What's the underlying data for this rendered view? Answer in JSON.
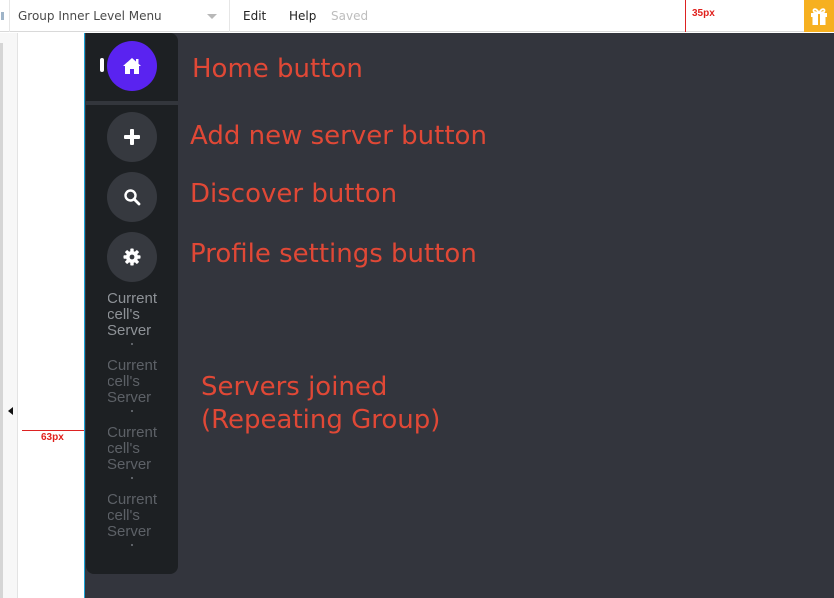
{
  "topbar": {
    "page_selector": "Group Inner Level Menu",
    "menu": [
      "Edit",
      "Help"
    ],
    "status": "Saved",
    "ruler_top_label": "35px",
    "gift_icon": "gift-icon"
  },
  "editor": {
    "ruler_left_label": "63px",
    "collapse_icon": "triangle-left-icon"
  },
  "sidebar": {
    "home_icon": "home-icon",
    "buttons": [
      {
        "name": "add-server",
        "icon": "plus-icon"
      },
      {
        "name": "discover",
        "icon": "search-icon"
      },
      {
        "name": "profile-settings",
        "icon": "gear-icon"
      }
    ],
    "servers": [
      {
        "lines": [
          "Current",
          "cell's",
          "Server"
        ]
      },
      {
        "lines": [
          "Current",
          "cell's",
          "Server"
        ]
      },
      {
        "lines": [
          "Current",
          "cell's",
          "Server"
        ]
      },
      {
        "lines": [
          "Current",
          "cell's",
          "Server"
        ]
      }
    ]
  },
  "annotations": {
    "home": "Home button",
    "add": "Add new server button",
    "discover": "Discover button",
    "profile": "Profile settings button",
    "servers_line1": "Servers joined",
    "servers_line2": "(Repeating Group)"
  },
  "colors": {
    "accent": "#5a23f0",
    "annotation": "#e04836",
    "canvas": "#33353d",
    "sidebar": "#1d2023",
    "gift": "#f6b020"
  }
}
